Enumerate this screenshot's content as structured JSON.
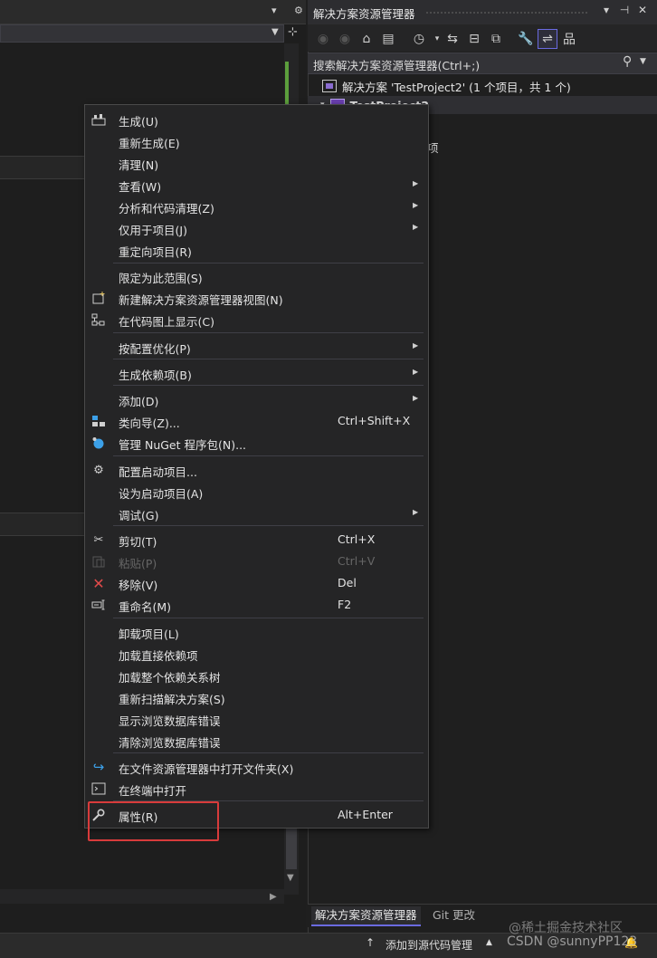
{
  "editor": {
    "pin_tools": "▾ ⚙"
  },
  "solution_explorer": {
    "title": "解决方案资源管理器",
    "title_buttons": [
      "▾",
      "⊣",
      "✕"
    ],
    "search_placeholder": "搜索解决方案资源管理器(Ctrl+;)",
    "tree": {
      "solution_label": "解决方案 'TestProject2' (1 个项目，共 1 个)",
      "project_label": "TestProject2",
      "partial_text": "项"
    },
    "tabs": [
      {
        "label": "解决方案资源管理器",
        "active": true
      },
      {
        "label": "Git 更改",
        "active": false
      }
    ]
  },
  "status_bar": {
    "up_arrow": "↑",
    "text": "添加到源代码管理",
    "caret": "▲",
    "bell": "🔔"
  },
  "watermark": {
    "line1": "@稀土掘金技术社区",
    "line2": "CSDN @sunnyPP123"
  },
  "context_menu": {
    "items": [
      {
        "label": "生成(U)",
        "shortcut": "",
        "icon": "build-icon"
      },
      {
        "label": "重新生成(E)",
        "shortcut": ""
      },
      {
        "label": "清理(N)",
        "shortcut": ""
      },
      {
        "label": "查看(W)",
        "shortcut": "",
        "submenu": true
      },
      {
        "label": "分析和代码清理(Z)",
        "shortcut": "",
        "submenu": true
      },
      {
        "label": "仅用于项目(J)",
        "shortcut": "",
        "submenu": true
      },
      {
        "label": "重定向项目(R)",
        "shortcut": ""
      },
      {
        "label": "限定为此范围(S)",
        "shortcut": ""
      },
      {
        "label": "新建解决方案资源管理器视图(N)",
        "shortcut": "",
        "icon": "new-view-icon"
      },
      {
        "label": "在代码图上显示(C)",
        "shortcut": "",
        "icon": "code-map-icon"
      },
      {
        "label": "按配置优化(P)",
        "shortcut": "",
        "submenu": true
      },
      {
        "label": "生成依赖项(B)",
        "shortcut": "",
        "submenu": true
      },
      {
        "label": "添加(D)",
        "shortcut": "",
        "submenu": true
      },
      {
        "label": "类向导(Z)...",
        "shortcut": "Ctrl+Shift+X",
        "icon": "class-wizard-icon"
      },
      {
        "label": "管理 NuGet 程序包(N)...",
        "shortcut": "",
        "icon": "nuget-icon"
      },
      {
        "label": "配置启动项目...",
        "shortcut": "",
        "icon": "gear-icon"
      },
      {
        "label": "设为启动项目(A)",
        "shortcut": ""
      },
      {
        "label": "调试(G)",
        "shortcut": "",
        "submenu": true
      },
      {
        "label": "剪切(T)",
        "shortcut": "Ctrl+X",
        "icon": "scissors-icon"
      },
      {
        "label": "粘贴(P)",
        "shortcut": "Ctrl+V",
        "icon": "paste-icon",
        "disabled": true
      },
      {
        "label": "移除(V)",
        "shortcut": "Del",
        "icon": "remove-icon"
      },
      {
        "label": "重命名(M)",
        "shortcut": "F2",
        "icon": "rename-icon"
      },
      {
        "label": "卸载项目(L)",
        "shortcut": ""
      },
      {
        "label": "加载直接依赖项",
        "shortcut": ""
      },
      {
        "label": "加载整个依赖关系树",
        "shortcut": ""
      },
      {
        "label": "重新扫描解决方案(S)",
        "shortcut": ""
      },
      {
        "label": "显示浏览数据库错误",
        "shortcut": ""
      },
      {
        "label": "清除浏览数据库错误",
        "shortcut": ""
      },
      {
        "label": "在文件资源管理器中打开文件夹(X)",
        "shortcut": "",
        "icon": "open-folder-icon"
      },
      {
        "label": "在终端中打开",
        "shortcut": "",
        "icon": "terminal-icon"
      },
      {
        "label": "属性(R)",
        "shortcut": "Alt+Enter",
        "icon": "wrench-icon"
      }
    ],
    "colors": {
      "highlight_box": "#d83b3b",
      "remove_icon": "#e04a4a",
      "accent_blue": "#3ca0e8"
    }
  }
}
